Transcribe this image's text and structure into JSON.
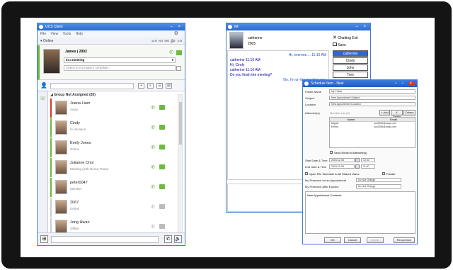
{
  "ucs": {
    "title": "UCS Client",
    "menu": [
      "File",
      "View",
      "Tools",
      "Help"
    ],
    "status": "Online",
    "counts": [
      "0",
      "0",
      "0",
      "0",
      "0"
    ],
    "profile": {
      "name": "James | 2002",
      "presence": "In a meeting",
      "schedule_placeholder": "Check to my today's schedule..."
    },
    "group_header": "Group Not Assigned (20)",
    "contacts": [
      {
        "name": "Juana Liam",
        "status": "Away"
      },
      {
        "name": "Cindy",
        "status": "In Vacation"
      },
      {
        "name": "Emily Jones",
        "status": "Online"
      },
      {
        "name": "Julianne Choi",
        "status": "Meeting (with Nexus Team)"
      },
      {
        "name": "peter0047",
        "status": "Member"
      },
      {
        "name": "2067",
        "status": "Online"
      },
      {
        "name": "Jong Hwan",
        "status": "Offline"
      }
    ]
  },
  "chat": {
    "title": "IM",
    "user_name": "catherine",
    "user_ext": "2005",
    "exit_label": "Chatting Exit",
    "save_label": "Save",
    "messages": [
      {
        "text": "Hi, everone.... 11:16 AM",
        "align": "right"
      },
      {
        "text": "catherine  11:16 AM",
        "align": "left"
      },
      {
        "text": "Hi, Cindy",
        "align": "left"
      },
      {
        "text": "catherine  11:16 AM",
        "align": "left"
      },
      {
        "text": "Do you finish the meeting?",
        "align": "left"
      },
      {
        "text": "No, I'm on the meeting now",
        "align": "right"
      }
    ],
    "users": [
      "catherine",
      "Cindy",
      "John",
      "Tom"
    ]
  },
  "schedule": {
    "title": "Schedule Item - New",
    "labels": {
      "folder": "Folder Name",
      "subject": "Subject",
      "location": "Location",
      "attendees": "Attendee(s)",
      "start": "Start Date & Time",
      "end": "End Date & Time",
      "presence": "My Presence for an Appointment",
      "after": "My Presence After Expired"
    },
    "values": {
      "folder": "My Folder",
      "subject": "New Appointment Subject",
      "location": "New Appointment Location",
      "member_list": "Member List (2)",
      "start_date": "2015-12-05",
      "start_time": "10:30",
      "end_date": "2015-12-05",
      "end_time": "11:00",
      "presence": "Do Not Change",
      "after": "Do Not Change",
      "contents": "New Appointment Contents"
    },
    "buttons": {
      "add": "+ Add",
      "delete": "X Delete",
      "others": "Others",
      "ok": "OK",
      "cancel": "Cancel",
      "delete2": "Delete",
      "recurrence": "Recurrence"
    },
    "grid_headers": [
      "Name",
      "Email"
    ],
    "attendees": [
      {
        "name": "Miguel",
        "email": "ucs2000@ucsp.com"
      },
      {
        "name": "Emma",
        "email": "ucs2006@ucsp.com"
      }
    ],
    "checks": {
      "send_email": "Send Email to Attendee(s)",
      "open_file": "Open File Schedule to All Shared Users",
      "private": "Private"
    }
  }
}
